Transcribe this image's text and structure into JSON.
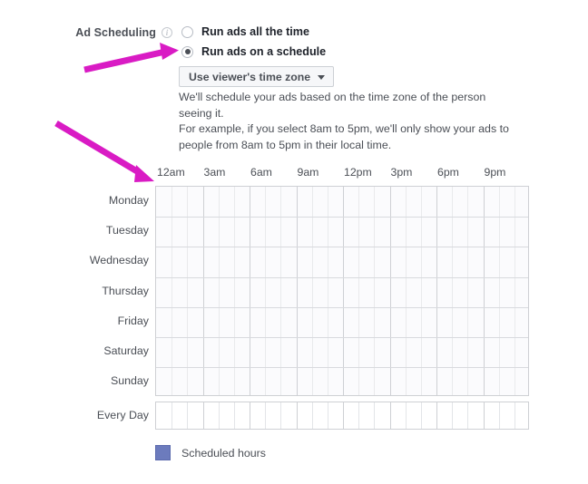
{
  "field": {
    "label": "Ad Scheduling",
    "info_icon": "info-icon",
    "info_glyph": "i"
  },
  "options": [
    {
      "label": "Run ads all the time",
      "selected": false
    },
    {
      "label": "Run ads on a schedule",
      "selected": true
    }
  ],
  "timezone_dropdown": {
    "value": "Use viewer's time zone",
    "caret_icon": "chevron-down-icon"
  },
  "description": {
    "line1": "We'll schedule your ads based on the time zone of the person",
    "line2": "seeing it.",
    "line3": "For example, if you select 8am to 5pm, we'll only show your ads to",
    "line4": "people from 8am to 5pm in their local time."
  },
  "schedule": {
    "time_labels": [
      "12am",
      "3am",
      "6am",
      "9am",
      "12pm",
      "3pm",
      "6pm",
      "9pm"
    ],
    "hours_per_day": 24,
    "major_divisions": 8,
    "days": [
      "Monday",
      "Tuesday",
      "Wednesday",
      "Thursday",
      "Friday",
      "Saturday",
      "Sunday"
    ],
    "every_day_label": "Every Day",
    "selected_hours": []
  },
  "legend": {
    "swatch_color": "#6c7bbd",
    "label": "Scheduled hours"
  },
  "annotations": {
    "arrow_color": "#d91bc4",
    "arrow_1": "arrow-to-schedule-radio",
    "arrow_2": "arrow-to-schedule-grid"
  }
}
